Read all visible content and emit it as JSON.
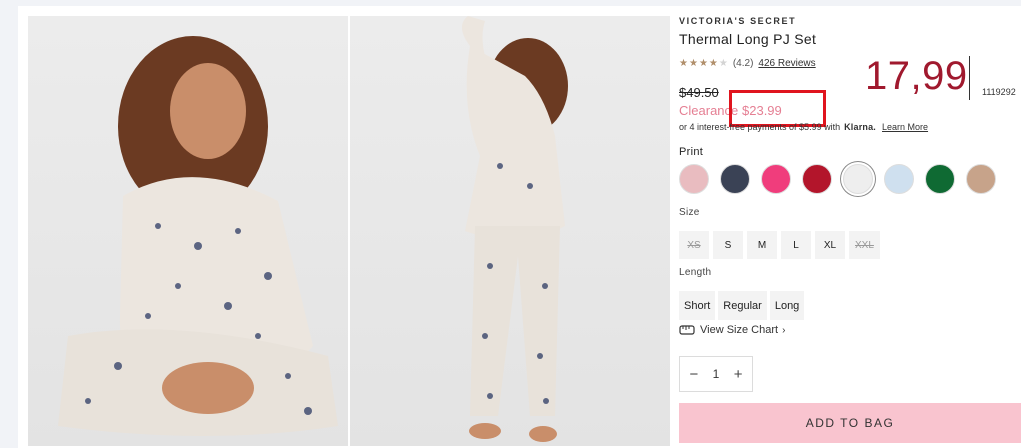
{
  "product": {
    "brand": "VICTORIA'S SECRET",
    "title": "Thermal Long PJ Set",
    "rating": {
      "stars_filled": 4,
      "stars_total": 5,
      "value_text": "(4.2)",
      "reviews_text": "426 Reviews"
    },
    "overlay_price": "17,99",
    "sku_partial": "1119292",
    "old_price": "$49.50",
    "clearance_label": "Clearance",
    "clearance_price": "$23.99",
    "klarna": {
      "pre": "or 4 interest-free payments of $5.99 with",
      "brand": "Klarna.",
      "learn_more": "Learn More"
    }
  },
  "print": {
    "label": "Print",
    "swatches": [
      {
        "name": "pink-stripe",
        "color": "#e9bcc0"
      },
      {
        "name": "navy-floral",
        "color": "#3a4255"
      },
      {
        "name": "hot-pink",
        "color": "#f03d7c"
      },
      {
        "name": "red-plaid",
        "color": "#b3152b"
      },
      {
        "name": "snowflake-white",
        "color": "#eeeeee"
      },
      {
        "name": "light-blue-tiedye",
        "color": "#cfe0ef"
      },
      {
        "name": "green-plaid",
        "color": "#0f6a33"
      },
      {
        "name": "leopard",
        "color": "#c7a38a"
      }
    ],
    "selected_index": 4
  },
  "size": {
    "label": "Size",
    "options": [
      {
        "label": "XS",
        "available": false
      },
      {
        "label": "S",
        "available": true
      },
      {
        "label": "M",
        "available": true
      },
      {
        "label": "L",
        "available": true
      },
      {
        "label": "XL",
        "available": true
      },
      {
        "label": "XXL",
        "available": false
      }
    ]
  },
  "length": {
    "label": "Length",
    "options": [
      "Short",
      "Regular",
      "Long"
    ]
  },
  "size_chart_text": "View Size Chart",
  "quantity": {
    "minus": "−",
    "value": "1",
    "plus": "+"
  },
  "add_to_bag": "ADD TO BAG",
  "colors": {
    "clearance": "#e57f93",
    "add_button": "#f9c4cf",
    "highlight": "#e0141e",
    "overlay_price": "#a0192e"
  }
}
